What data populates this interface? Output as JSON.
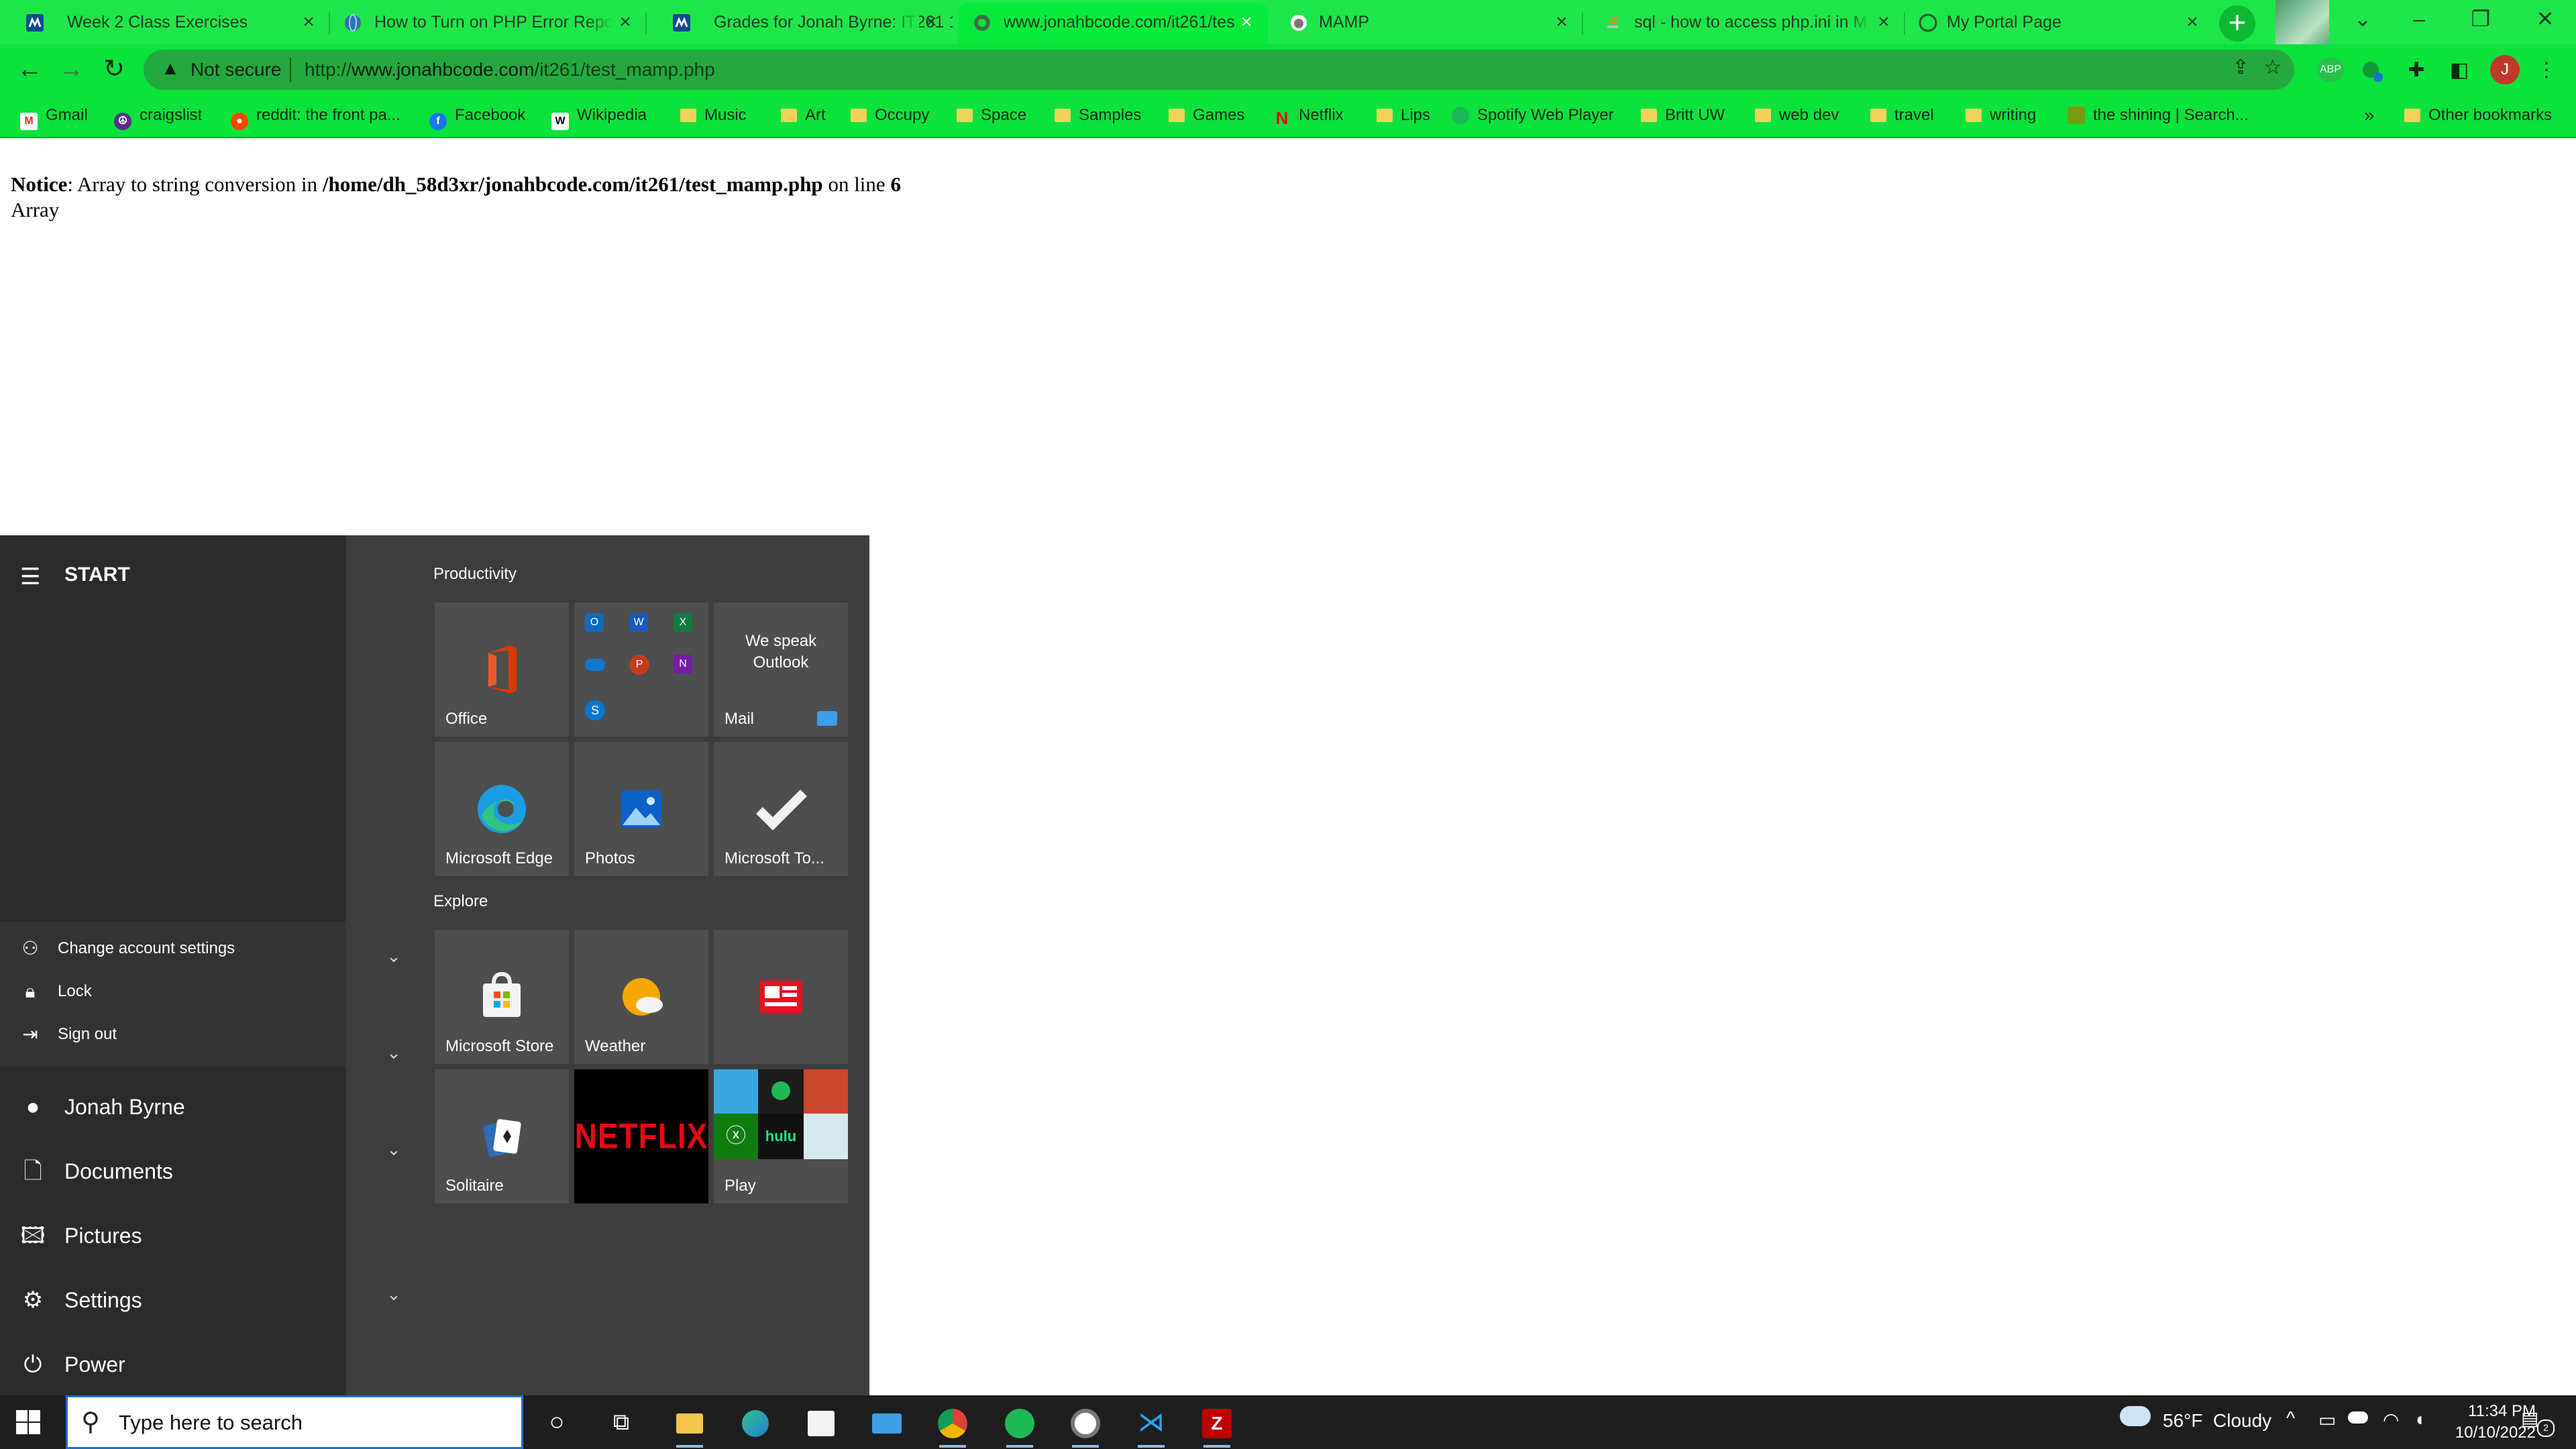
{
  "browser": {
    "tabs": [
      {
        "title": "Week 2 Class Exercises",
        "active": false
      },
      {
        "title": "How to Turn on PHP Error Repo",
        "active": false
      },
      {
        "title": "Grades for Jonah Byrne: IT261 1",
        "active": false
      },
      {
        "title": "www.jonahbcode.com/it261/tes",
        "active": true
      },
      {
        "title": "MAMP",
        "active": false
      },
      {
        "title": "sql - how to access php.ini in M",
        "active": false
      },
      {
        "title": "My Portal Page",
        "active": false
      }
    ],
    "new_tab_symbol": "+",
    "security_label": "Not secure",
    "url_prefix": "http://",
    "url_domain": "www.jonahbcode.com",
    "url_path": "/it261/test_mamp.php",
    "profile_initial": "J",
    "extension_badge": "ABP",
    "bookmarks": [
      {
        "label": "Gmail",
        "type": "site",
        "icon": "gmail-icon"
      },
      {
        "label": "craigslist",
        "type": "site",
        "icon": "peace-icon"
      },
      {
        "label": "reddit: the front pa...",
        "type": "site",
        "icon": "reddit-icon"
      },
      {
        "label": "Facebook",
        "type": "site",
        "icon": "facebook-icon"
      },
      {
        "label": "Wikipedia",
        "type": "site",
        "icon": "wikipedia-icon"
      },
      {
        "label": "Music",
        "type": "folder"
      },
      {
        "label": "Art",
        "type": "folder"
      },
      {
        "label": "Occupy",
        "type": "folder"
      },
      {
        "label": "Space",
        "type": "folder"
      },
      {
        "label": "Samples",
        "type": "folder"
      },
      {
        "label": "Games",
        "type": "folder"
      },
      {
        "label": "Netflix",
        "type": "site",
        "icon": "netflix-icon"
      },
      {
        "label": "Lips",
        "type": "folder"
      },
      {
        "label": "Spotify Web Player",
        "type": "site",
        "icon": "spotify-icon"
      },
      {
        "label": "Britt UW",
        "type": "folder"
      },
      {
        "label": "web dev",
        "type": "folder"
      },
      {
        "label": "travel",
        "type": "folder"
      },
      {
        "label": "writing",
        "type": "folder"
      },
      {
        "label": "the shining | Search...",
        "type": "site",
        "icon": "search-site-icon"
      }
    ],
    "bookmarks_overflow": "»",
    "other_bookmarks": "Other bookmarks"
  },
  "page": {
    "notice_label": "Notice",
    "notice_text": ": Array to string conversion in ",
    "notice_path": "/home/dh_58d3xr/jonahbcode.com/it261/test_mamp.php",
    "notice_mid": " on line ",
    "notice_line": "6",
    "output": "Array"
  },
  "start_menu": {
    "title": "START",
    "account_menu": [
      "Change account settings",
      "Lock",
      "Sign out"
    ],
    "nav": [
      {
        "label": "Jonah Byrne",
        "icon": "user-icon"
      },
      {
        "label": "Documents",
        "icon": "document-icon"
      },
      {
        "label": "Pictures",
        "icon": "pictures-icon"
      },
      {
        "label": "Settings",
        "icon": "gear-icon"
      },
      {
        "label": "Power",
        "icon": "power-icon"
      }
    ],
    "groups": [
      {
        "title": "Productivity",
        "tiles": [
          {
            "label": "Office"
          },
          {
            "label": ""
          },
          {
            "label": "Mail",
            "subtitle": "We speak Outlook"
          },
          {
            "label": "Microsoft Edge"
          },
          {
            "label": "Photos"
          },
          {
            "label": "Microsoft To..."
          }
        ]
      },
      {
        "title": "Explore",
        "tiles": [
          {
            "label": "Microsoft Store"
          },
          {
            "label": "Weather"
          },
          {
            "label": ""
          },
          {
            "label": "Solitaire"
          },
          {
            "label": "",
            "logo": "NETFLIX"
          },
          {
            "label": "Play",
            "logo_small": "hulu"
          }
        ]
      }
    ]
  },
  "taskbar": {
    "search_placeholder": "Type here to search",
    "apps": [
      "cortana-icon",
      "task-view-icon",
      "file-explorer-icon",
      "edge-icon",
      "store-icon",
      "mail-icon",
      "chrome-icon",
      "spotify-icon",
      "mamp-icon",
      "vscode-icon",
      "filezilla-icon"
    ],
    "weather": "56°F  Cloudy",
    "time": "11:34 PM",
    "date": "10/10/2022",
    "notification_count": "2"
  },
  "colors": {
    "tab_bar": "#1ee64a",
    "toolbar": "#0be23c",
    "start_bg": "#3d3d3d",
    "start_rail": "#2b2b2b",
    "tile": "#4e4e4e",
    "taskbar": "#1e1e1e"
  }
}
